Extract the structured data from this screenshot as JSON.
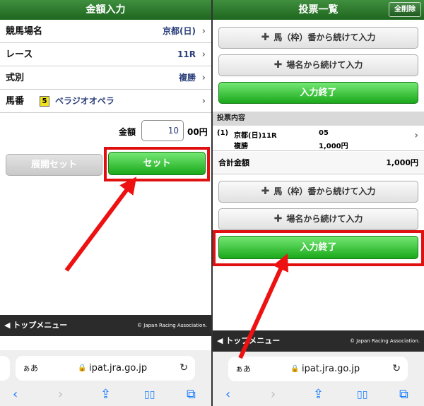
{
  "left": {
    "title": "金額入力",
    "rows": [
      {
        "label": "競馬場名",
        "value": "京都(日)"
      },
      {
        "label": "レース",
        "value": "11R"
      },
      {
        "label": "式別",
        "value": "複勝"
      },
      {
        "label": "馬番",
        "waku": "5",
        "value": "ベラジオオペラ"
      }
    ],
    "amount": {
      "label": "金額",
      "value": "10",
      "unit": "00円"
    },
    "deploy_button": "展開セット",
    "set_button": "セット",
    "footer": {
      "menu": "トップメニュー",
      "copyright": "© Japan Racing Association."
    },
    "browser": {
      "aa": "ぁあ",
      "host": "ipat.jra.go.jp"
    }
  },
  "right": {
    "title": "投票一覧",
    "clear_all": "全削除",
    "buttons": {
      "by_number": "馬（枠）番から続けて入力",
      "by_name": "場名から続けて入力",
      "finish": "入力終了"
    },
    "section_title": "投票内容",
    "ticket": {
      "index": "(1)",
      "venue_race": "京都(日)11R",
      "bet_type": "複勝",
      "horse_no": "05",
      "amount": "1,000円"
    },
    "total": {
      "label": "合計金額",
      "value": "1,000円"
    },
    "footer": {
      "menu": "トップメニュー",
      "copyright": "© Japan Racing Association."
    },
    "browser": {
      "aa": "ぁあ",
      "host": "ipat.jra.go.jp"
    }
  },
  "icons": {
    "chevron": "›",
    "plus": "✚",
    "back": "‹",
    "forward": "›",
    "share": "⇪",
    "bookmarks": "▯▯",
    "tabs": "⧉",
    "lock": "🔒",
    "reload": "↻"
  },
  "colors": {
    "accent_green": "#1aa81a",
    "highlight_red": "#e01010",
    "title_green": "#2b7a2b"
  }
}
